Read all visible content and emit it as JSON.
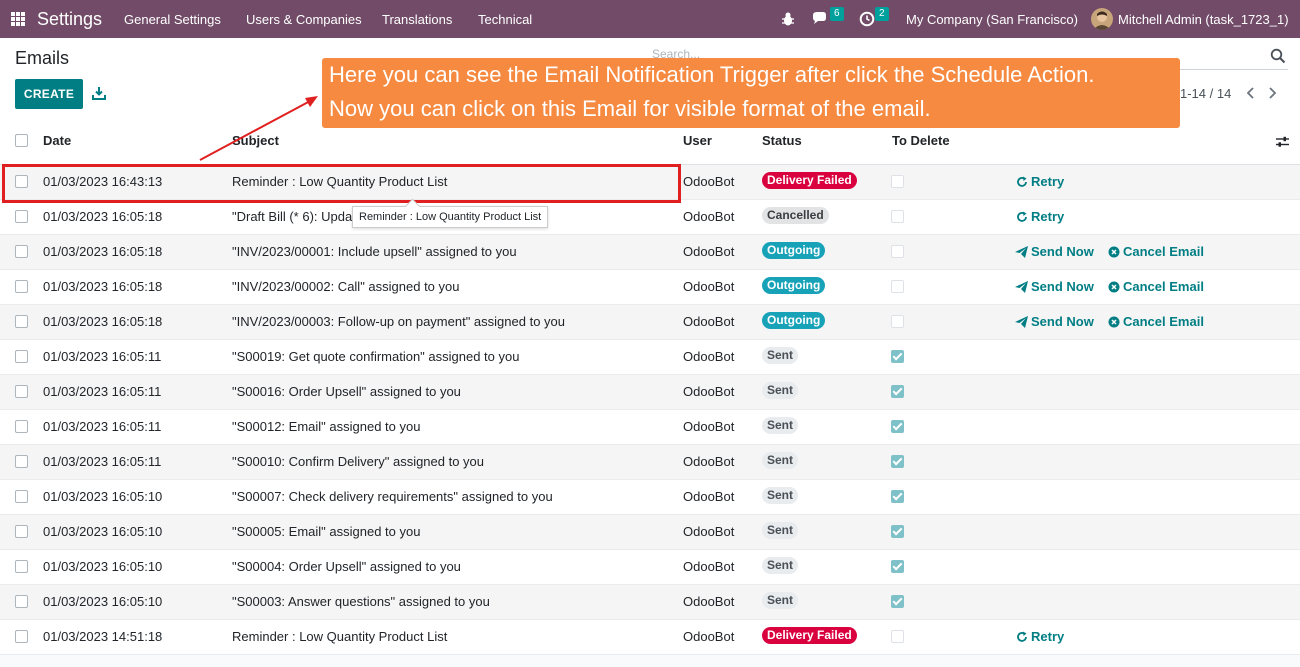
{
  "navbar": {
    "title": "Settings",
    "menu": [
      "General Settings",
      "Users & Companies",
      "Translations",
      "Technical"
    ],
    "messages_count": "6",
    "activities_count": "2",
    "company": "My Company (San Francisco)",
    "user": "Mitchell Admin (task_1723_1)"
  },
  "control": {
    "title": "Emails",
    "create_label": "CREATE",
    "search_placeholder": "Search...",
    "pager": "1-14 / 14"
  },
  "table": {
    "headers": {
      "date": "Date",
      "subject": "Subject",
      "user": "User",
      "status": "Status",
      "to_delete": "To Delete"
    },
    "rows": [
      {
        "date": "01/03/2023 16:43:13",
        "subject": "Reminder : Low Quantity Product List",
        "user": "OdooBot",
        "status": "Delivery Failed",
        "to_delete": false,
        "actions": [
          "Retry"
        ]
      },
      {
        "date": "01/03/2023 16:05:18",
        "subject": "\"Draft Bill (* 6): Upda",
        "user": "OdooBot",
        "status": "Cancelled",
        "to_delete": false,
        "actions": [
          "Retry"
        ]
      },
      {
        "date": "01/03/2023 16:05:18",
        "subject": "\"INV/2023/00001: Include upsell\" assigned to you",
        "user": "OdooBot",
        "status": "Outgoing",
        "to_delete": false,
        "actions": [
          "Send Now",
          "Cancel Email"
        ]
      },
      {
        "date": "01/03/2023 16:05:18",
        "subject": "\"INV/2023/00002: Call\" assigned to you",
        "user": "OdooBot",
        "status": "Outgoing",
        "to_delete": false,
        "actions": [
          "Send Now",
          "Cancel Email"
        ]
      },
      {
        "date": "01/03/2023 16:05:18",
        "subject": "\"INV/2023/00003: Follow-up on payment\" assigned to you",
        "user": "OdooBot",
        "status": "Outgoing",
        "to_delete": false,
        "actions": [
          "Send Now",
          "Cancel Email"
        ]
      },
      {
        "date": "01/03/2023 16:05:11",
        "subject": "\"S00019: Get quote confirmation\" assigned to you",
        "user": "OdooBot",
        "status": "Sent",
        "to_delete": true,
        "actions": []
      },
      {
        "date": "01/03/2023 16:05:11",
        "subject": "\"S00016: Order Upsell\" assigned to you",
        "user": "OdooBot",
        "status": "Sent",
        "to_delete": true,
        "actions": []
      },
      {
        "date": "01/03/2023 16:05:11",
        "subject": "\"S00012: Email\" assigned to you",
        "user": "OdooBot",
        "status": "Sent",
        "to_delete": true,
        "actions": []
      },
      {
        "date": "01/03/2023 16:05:11",
        "subject": "\"S00010: Confirm Delivery\" assigned to you",
        "user": "OdooBot",
        "status": "Sent",
        "to_delete": true,
        "actions": []
      },
      {
        "date": "01/03/2023 16:05:10",
        "subject": "\"S00007: Check delivery requirements\" assigned to you",
        "user": "OdooBot",
        "status": "Sent",
        "to_delete": true,
        "actions": []
      },
      {
        "date": "01/03/2023 16:05:10",
        "subject": "\"S00005: Email\" assigned to you",
        "user": "OdooBot",
        "status": "Sent",
        "to_delete": true,
        "actions": []
      },
      {
        "date": "01/03/2023 16:05:10",
        "subject": "\"S00004: Order Upsell\" assigned to you",
        "user": "OdooBot",
        "status": "Sent",
        "to_delete": true,
        "actions": []
      },
      {
        "date": "01/03/2023 16:05:10",
        "subject": "\"S00003: Answer questions\" assigned to you",
        "user": "OdooBot",
        "status": "Sent",
        "to_delete": true,
        "actions": []
      },
      {
        "date": "01/03/2023 14:51:18",
        "subject": "Reminder : Low Quantity Product List",
        "user": "OdooBot",
        "status": "Delivery Failed",
        "to_delete": false,
        "actions": [
          "Retry"
        ]
      }
    ]
  },
  "callout": {
    "line1": "Here you can see the Email Notification Trigger after click the Schedule Action.",
    "line2": "Now you can click on this Email for visible format of the email."
  },
  "tooltip": "Reminder : Low Quantity Product List",
  "colors": {
    "navbar": "#714b67",
    "primary": "#017e84",
    "callout": "#f68a41",
    "failed": "#d9023f",
    "outgoing": "#17a2b8",
    "highlight": "#e02020"
  },
  "icons": {
    "apps": "apps-grid-icon",
    "bug": "bug-icon",
    "chat": "chat-icon",
    "clock": "clock-icon",
    "download": "download-icon",
    "search": "search-icon",
    "retry": "retry-icon",
    "send": "paper-plane-icon",
    "cancel": "times-circle-icon",
    "settings": "sliders-icon"
  }
}
